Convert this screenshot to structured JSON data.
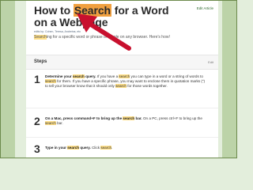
{
  "article": {
    "edit_label": "Edit Article",
    "title_pre": "How to ",
    "title_highlight": "Search",
    "title_post": " for a Word on a Webpage",
    "edits_text": "edits by: Cohen, Teresa, Andreina, etc",
    "intro_highlight": "Search",
    "intro_rest": "ing for a specific word or phrase is simple on any browser. Here's how!"
  },
  "steps": {
    "header": "Steps",
    "edit_label": "Edit",
    "items": [
      {
        "number": "1",
        "lead": "Determine your ",
        "lead_hl": "search",
        "lead_end": " query.",
        "t1": " If you have a ",
        "h1": "search",
        "t2": " you can type in a word or a string of words to ",
        "h2": "search",
        "t3": " for them. If you have a specific phrase, you may want to enclose them in quotation marks (\") to tell your browser know that it should only ",
        "h3": "search",
        "t4": " for those words together."
      },
      {
        "number": "2",
        "lead": "On a Mac, press command+F to bring up the ",
        "lead_hl": "search",
        "lead_end": " bar.",
        "t1": " On a PC, press ctrl+F to bring up the ",
        "h1": "search",
        "t2": " bar."
      },
      {
        "number": "3",
        "lead": "Type in your ",
        "lead_hl": "search",
        "lead_end": " query.",
        "t1": " Click ",
        "h1": "search",
        "t2": "."
      }
    ]
  },
  "colors": {
    "arrow": "#c8102e",
    "highlight": "#ffe08a",
    "title_highlight": "#f0a040",
    "background": "#e3eedc"
  },
  "icons": [
    "arrow-annotation-icon"
  ]
}
